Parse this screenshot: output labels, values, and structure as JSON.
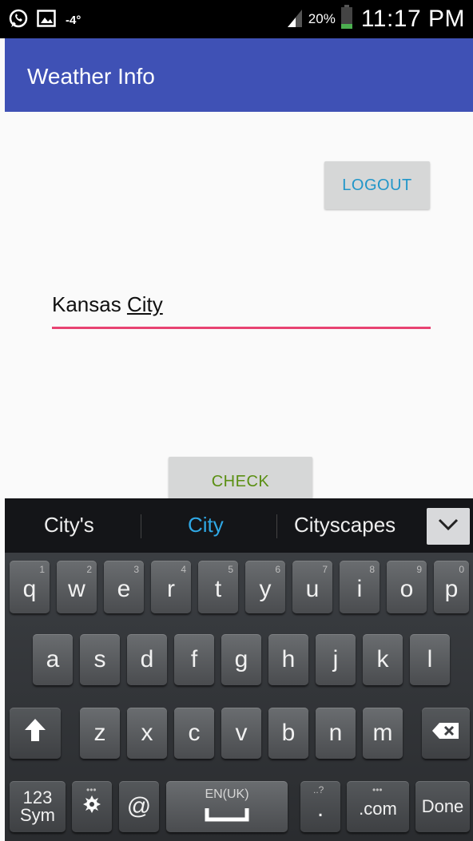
{
  "status_bar": {
    "temperature": "-4°",
    "battery_percent": "20%",
    "time": "11:17 PM"
  },
  "app_bar": {
    "title": "Weather Info"
  },
  "main": {
    "logout_label": "LOGOUT",
    "city_input": {
      "value_prefix": "Kansas ",
      "value_word": "City"
    },
    "check_label": "CHECK"
  },
  "suggestions": [
    "City's",
    "City",
    "Cityscapes"
  ],
  "keyboard": {
    "row1": [
      {
        "label": "q",
        "hint": "1"
      },
      {
        "label": "w",
        "hint": "2"
      },
      {
        "label": "e",
        "hint": "3"
      },
      {
        "label": "r",
        "hint": "4"
      },
      {
        "label": "t",
        "hint": "5"
      },
      {
        "label": "y",
        "hint": "6"
      },
      {
        "label": "u",
        "hint": "7"
      },
      {
        "label": "i",
        "hint": "8"
      },
      {
        "label": "o",
        "hint": "9"
      },
      {
        "label": "p",
        "hint": "0"
      }
    ],
    "row2": [
      "a",
      "s",
      "d",
      "f",
      "g",
      "h",
      "j",
      "k",
      "l"
    ],
    "row3": [
      "z",
      "x",
      "c",
      "v",
      "b",
      "n",
      "m"
    ],
    "sym_top": "123",
    "sym_bottom": "Sym",
    "at": "@",
    "space_label": "EN(UK)",
    "period": ".",
    "period_hint": "..?",
    "dotcom": ".com",
    "done": "Done",
    "dots_hint": "•••"
  },
  "colors": {
    "app_bar": "#3f51b5",
    "input_underline": "#e84372",
    "logout_text": "#2196c9",
    "check_text": "#5a8f12",
    "suggestion_selected": "#2fa8e5"
  }
}
